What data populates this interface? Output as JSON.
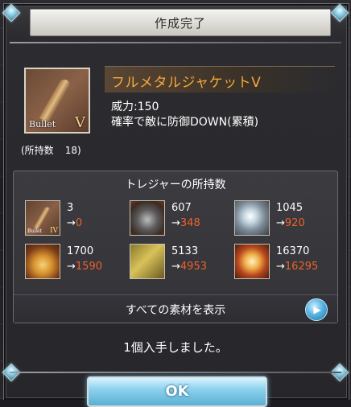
{
  "modal": {
    "title": "作成完了",
    "message": "1個入手しました。",
    "ok_label": "OK"
  },
  "item": {
    "name": "フルメタルジャケットV",
    "power": "威力:150",
    "effect": "確率で敵に防御DOWN(累積)",
    "category": "Bullet",
    "rank": "V",
    "owned_label": "(所持数",
    "owned_count": "18)"
  },
  "treasure": {
    "header": "トレジャーの所持数",
    "items": [
      {
        "icon": "bullet-icon",
        "count": "3",
        "arrow": "→",
        "after": "0"
      },
      {
        "icon": "gear-icon",
        "count": "607",
        "arrow": "→",
        "after": "348"
      },
      {
        "icon": "orb-icon",
        "count": "1045",
        "arrow": "→",
        "after": "920"
      },
      {
        "icon": "box-icon",
        "count": "1700",
        "arrow": "→",
        "after": "1590"
      },
      {
        "icon": "tablet-icon",
        "count": "5133",
        "arrow": "→",
        "after": "4953"
      },
      {
        "icon": "core-icon",
        "count": "16370",
        "arrow": "→",
        "after": "16295"
      }
    ],
    "mini_bullet_category": "Bullet",
    "mini_bullet_rank": "IV",
    "show_all_label": "すべての素材を表示"
  },
  "colors": {
    "item_name": "#f7a93c",
    "decrease_value": "#f0612a",
    "ok_button": "#8ed2ee"
  }
}
